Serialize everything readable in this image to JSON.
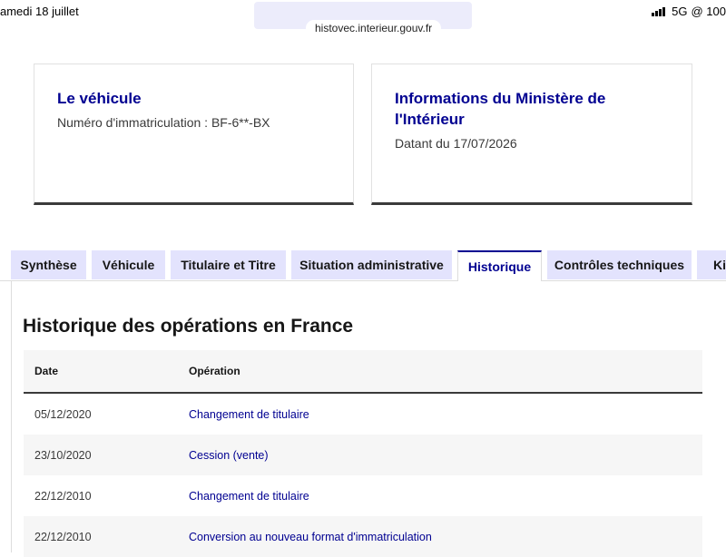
{
  "status_bar": {
    "date": "amedi 18 juillet",
    "network": "5G",
    "battery": "@ 100"
  },
  "browser": {
    "url": "histovec.interieur.gouv.fr"
  },
  "vehicle_card": {
    "title": "Le véhicule",
    "registration": "Numéro d'immatriculation : BF-6**-BX"
  },
  "ministry_card": {
    "title": "Informations du Ministère de l'Intérieur",
    "date_text": "Datant du 17/07/2026"
  },
  "tabs": [
    {
      "label": "Synthèse",
      "active": false
    },
    {
      "label": "Véhicule",
      "active": false
    },
    {
      "label": "Titulaire et Titre",
      "active": false
    },
    {
      "label": "Situation administrative",
      "active": false
    },
    {
      "label": "Historique",
      "active": true
    },
    {
      "label": "Contrôles techniques",
      "active": false
    },
    {
      "label": "Kilo",
      "active": false
    }
  ],
  "history": {
    "title": "Historique des opérations en France",
    "columns": {
      "date": "Date",
      "operation": "Opération"
    },
    "rows": [
      {
        "date": "05/12/2020",
        "operation": "Changement de titulaire"
      },
      {
        "date": "23/10/2020",
        "operation": "Cession (vente)"
      },
      {
        "date": "22/12/2010",
        "operation": "Changement de titulaire"
      },
      {
        "date": "22/12/2010",
        "operation": "Conversion au nouveau format d'immatriculation"
      }
    ]
  },
  "colors": {
    "brand_blue": "#000091",
    "tab_background": "#e3e3fd",
    "row_stripe": "#f6f6f6"
  }
}
